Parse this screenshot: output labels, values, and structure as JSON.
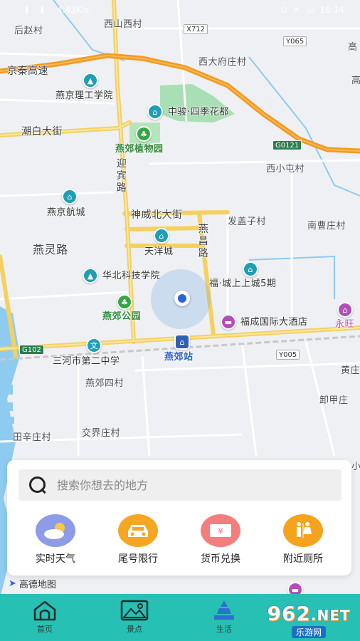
{
  "status_bar": {
    "left_text": "4.43K/s",
    "time": "16:14"
  },
  "map": {
    "road_labels": [
      {
        "id": "jingqin",
        "text": "京秦高速"
      },
      {
        "id": "chaobai",
        "text": "潮白大街"
      },
      {
        "id": "yingbin",
        "text": "迎宾路"
      },
      {
        "id": "shenwei",
        "text": "神威北大街"
      },
      {
        "id": "yanchang",
        "text": "燕昌路"
      },
      {
        "id": "yanling",
        "text": "燕灵路"
      }
    ],
    "shields": [
      {
        "id": "x712",
        "text": "X712"
      },
      {
        "id": "y065",
        "text": "Y065"
      },
      {
        "id": "g0121",
        "text": "G0121"
      },
      {
        "id": "g102",
        "text": "G102"
      },
      {
        "id": "y005",
        "text": "Y005"
      }
    ],
    "place_labels": [
      {
        "id": "houzhao",
        "text": "后赵村"
      },
      {
        "id": "xishanxi",
        "text": "西山西村"
      },
      {
        "id": "xidafu",
        "text": "西大府庄村"
      },
      {
        "id": "gao1",
        "text": "高"
      },
      {
        "id": "gao2",
        "text": "高"
      },
      {
        "id": "xixiaotun",
        "text": "西小屯村"
      },
      {
        "id": "fagaizi",
        "text": "发盖子村"
      },
      {
        "id": "nancao",
        "text": "南曹庄村"
      },
      {
        "id": "yanjiaosi",
        "text": "燕郊四村"
      },
      {
        "id": "tianxin",
        "text": "田辛庄村"
      },
      {
        "id": "jiaojie",
        "text": "交界庄村"
      },
      {
        "id": "huangzhuang",
        "text": "黄庄"
      },
      {
        "id": "xiexin",
        "text": "卸甲庄"
      },
      {
        "id": "xiao",
        "text": "小"
      }
    ],
    "poi_labels": [
      {
        "id": "ligong",
        "text": "燕京理工学院"
      },
      {
        "id": "zhongjun",
        "text": "中骏·四季花都"
      },
      {
        "id": "zhiwuyuan",
        "text": "燕郊植物园"
      },
      {
        "id": "hangcheng",
        "text": "燕京航城"
      },
      {
        "id": "tianyang",
        "text": "天洋城"
      },
      {
        "id": "huabei",
        "text": "华北科技学院"
      },
      {
        "id": "fucheng",
        "text": "福·城上上城5期"
      },
      {
        "id": "jiaogongyuan",
        "text": "燕郊公园"
      },
      {
        "id": "fucheng_hotel",
        "text": "福成国际大酒店"
      },
      {
        "id": "yongwang",
        "text": "永旺"
      },
      {
        "id": "sanhe",
        "text": "三河市第二中学"
      },
      {
        "id": "station",
        "text": "燕郊站"
      },
      {
        "id": "wen",
        "text": "文"
      }
    ],
    "attribution": "高德地图"
  },
  "search": {
    "placeholder": "搜索你想去的地方"
  },
  "tools": [
    {
      "id": "weather",
      "label": "实时天气",
      "icon": "weather-icon",
      "color": "#8e9be6"
    },
    {
      "id": "plate",
      "label": "尾号限行",
      "icon": "car-icon",
      "color": "#f5a623"
    },
    {
      "id": "exchange",
      "label": "货币兑换",
      "icon": "currency-icon",
      "color": "#f47d7d"
    },
    {
      "id": "toilet",
      "label": "附近厕所",
      "icon": "toilet-icon",
      "color": "#f5a31c"
    }
  ],
  "tabs": [
    {
      "id": "home",
      "label": "首页",
      "icon": "home-icon"
    },
    {
      "id": "scenic",
      "label": "景点",
      "icon": "image-icon"
    },
    {
      "id": "life",
      "label": "生活",
      "icon": "tower-icon"
    }
  ],
  "brand": {
    "number": "962",
    "suffix": ".NET",
    "sub": "乐游网"
  },
  "colors": {
    "tabbar": "#26c1b4",
    "highway": "#f29a21",
    "road": "#f7d46a",
    "water": "#8ecbf0",
    "park": "#a9dfb4"
  }
}
